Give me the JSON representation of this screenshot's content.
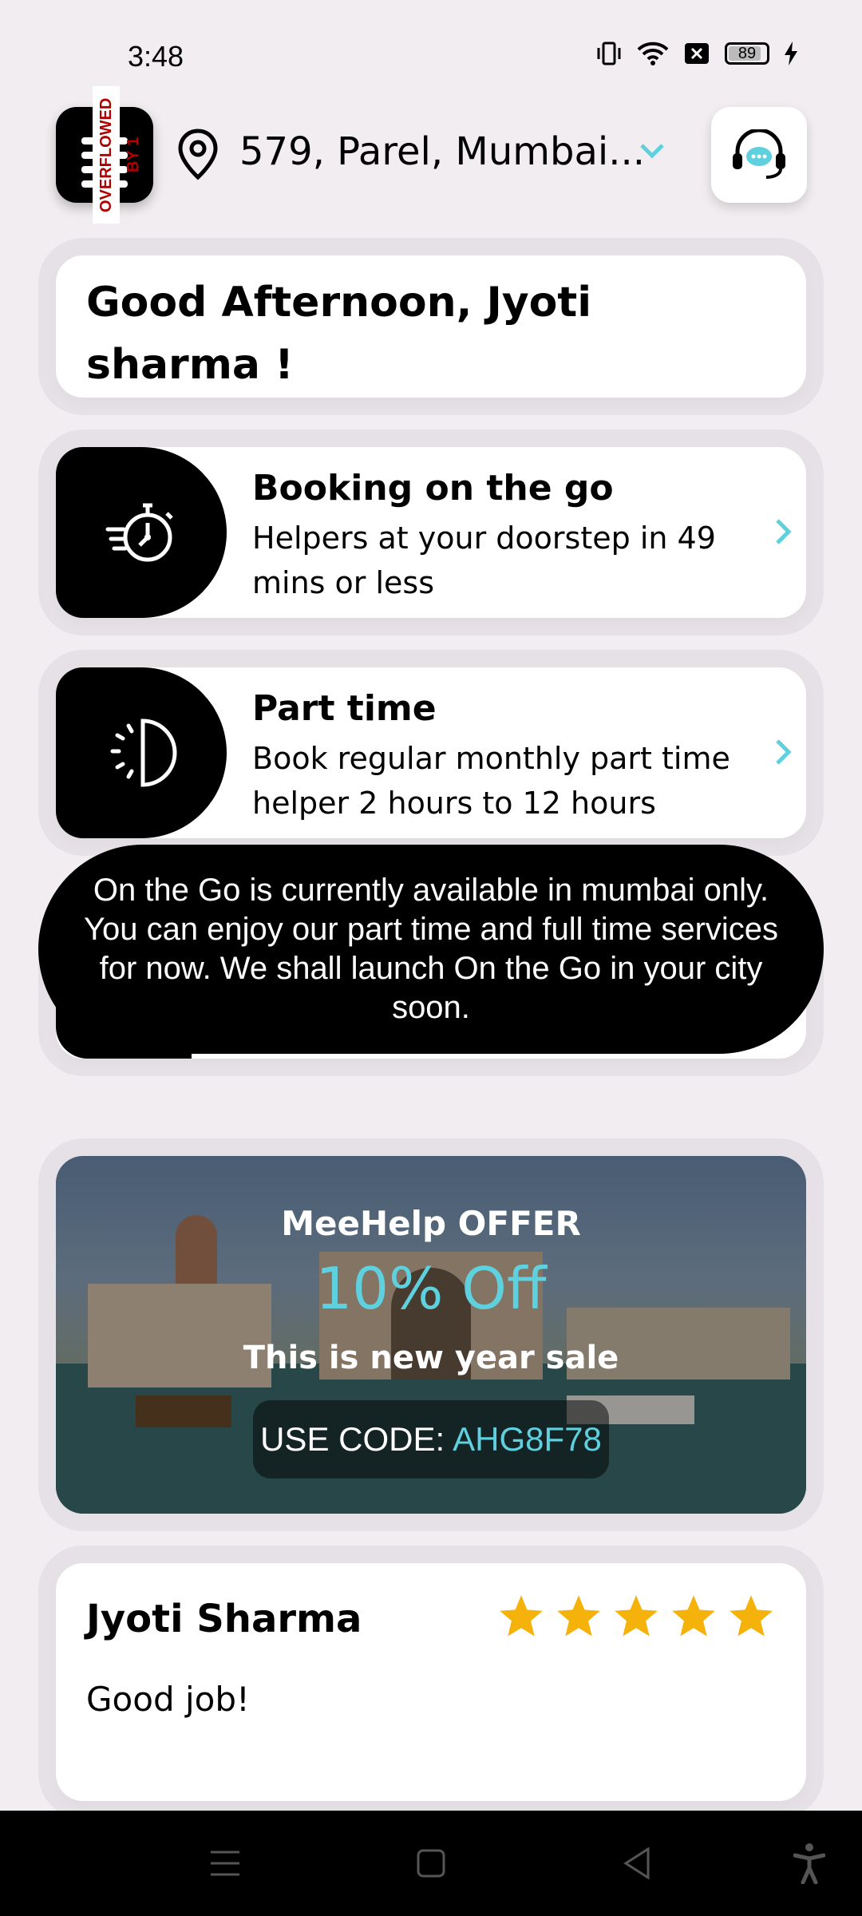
{
  "status": {
    "time": "3:48",
    "battery": "89"
  },
  "header": {
    "location": "579, Parel, Mumbai...",
    "overflow_label": "OVERFLOWED BY 1"
  },
  "greeting": "Good Afternoon, Jyoti sharma !",
  "services": [
    {
      "title": "Booking on the go",
      "description": "Helpers at your doorstep in 49 mins or less"
    },
    {
      "title": "Part time",
      "description": "Book regular monthly part time helper 2 hours to 12 hours"
    }
  ],
  "toast": "On the Go is currently available in mumbai only. You can enjoy our part time and full time services for now. We shall launch On the Go in your city soon.",
  "offer": {
    "title": "MeeHelp OFFER",
    "discount": "10% Off",
    "subtitle": "This is new year sale",
    "code_label": "USE CODE:",
    "code_value": "AHG8F78"
  },
  "review": {
    "name": "Jyoti Sharma",
    "text": "Good job!",
    "rating": 5
  },
  "colors": {
    "accent": "#5fd0dd",
    "star": "#f5b20a"
  },
  "icons": [
    "menu-icon",
    "location-pin-icon",
    "chevron-down-icon",
    "support-chat-icon",
    "stopwatch-icon",
    "half-clock-icon",
    "chevron-right-icon",
    "star-icon",
    "nav-menu-icon",
    "nav-home-icon",
    "nav-back-icon",
    "accessibility-icon"
  ]
}
